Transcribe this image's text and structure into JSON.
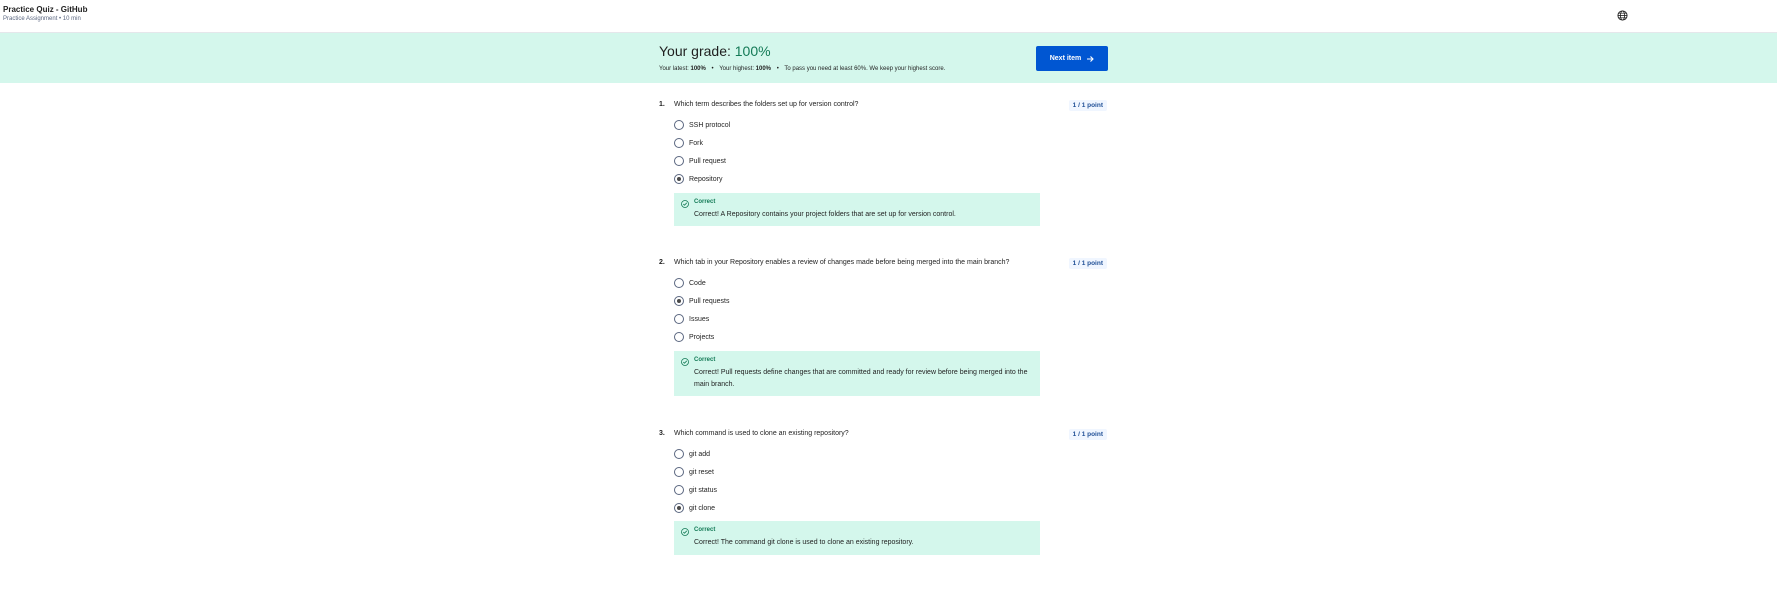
{
  "header": {
    "title": "Practice Quiz - GitHub",
    "subtitle": "Practice Assignment • 10 min",
    "globe_icon": "globe-icon"
  },
  "grade": {
    "label": "Your grade: ",
    "value": "100%",
    "latest_label": "Your latest:",
    "latest_value": "100%",
    "highest_label": "Your highest:",
    "highest_value": "100%",
    "pass_note": "To pass you need at least 60%. We keep your highest score.",
    "separator": "•",
    "accent_color": "#137a56",
    "banner_color": "#d4f7ec"
  },
  "next_button": {
    "label": "Next item",
    "icon": "arrow-right-icon",
    "color": "#0056d2"
  },
  "questions": [
    {
      "number": "1.",
      "text": "Which term describes the folders set up for version control?",
      "points": "1 / 1 point",
      "options": [
        "SSH protocol",
        "Fork",
        "Pull request",
        "Repository"
      ],
      "selected_index": 3,
      "feedback_title": "Correct",
      "feedback_text": "Correct! A Repository contains your project folders that are set up for version control."
    },
    {
      "number": "2.",
      "text": "Which tab in your Repository enables a review of changes made before being merged into the main branch?",
      "points": "1 / 1 point",
      "options": [
        "Code",
        "Pull requests",
        "Issues",
        "Projects"
      ],
      "selected_index": 1,
      "feedback_title": "Correct",
      "feedback_text": "Correct! Pull requests define changes that are committed and ready for review before being merged into the main branch."
    },
    {
      "number": "3.",
      "text": "Which command is used to clone an existing repository?",
      "points": "1 / 1 point",
      "options": [
        "git add",
        "git reset",
        "git status",
        "git clone"
      ],
      "selected_index": 3,
      "feedback_title": "Correct",
      "feedback_text": "Correct! The command git clone is used to clone an existing repository."
    }
  ]
}
